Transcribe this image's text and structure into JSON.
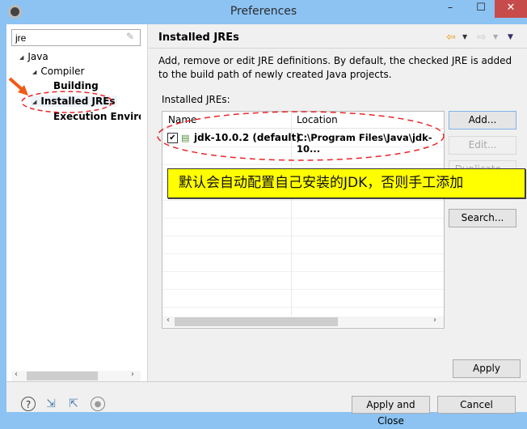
{
  "window": {
    "title": "Preferences",
    "minimize": "–",
    "maximize": "☐",
    "close": "✕"
  },
  "sidebar": {
    "search_value": "jre",
    "tree": [
      {
        "label": "Java",
        "expanded": true
      },
      {
        "label": "Compiler",
        "expanded": true
      },
      {
        "label": "Building"
      },
      {
        "label": "Installed JREs",
        "expanded": true,
        "selected": true
      },
      {
        "label": "Execution Environi"
      }
    ]
  },
  "page": {
    "title": "Installed JREs",
    "description": "Add, remove or edit JRE definitions. By default, the checked JRE is added to the build path of newly created Java projects.",
    "list_label": "Installed JREs:",
    "columns": [
      "Name",
      "Location"
    ],
    "rows": [
      {
        "checked": true,
        "name": "jdk-10.0.2 (default)",
        "location": "C:\\Program Files\\Java\\jdk-10..."
      }
    ],
    "buttons": {
      "add": "Add...",
      "edit": "Edit...",
      "duplicate": "Duplicate...",
      "search": "Search..."
    },
    "apply": "Apply"
  },
  "annotation": {
    "text": "默认会自动配置自己安装的JDK，否则手工添加",
    "highlight_color": "#ffff00",
    "mark_color": "#e8262a"
  },
  "footer": {
    "apply_close": "Apply and Close",
    "cancel": "Cancel"
  }
}
